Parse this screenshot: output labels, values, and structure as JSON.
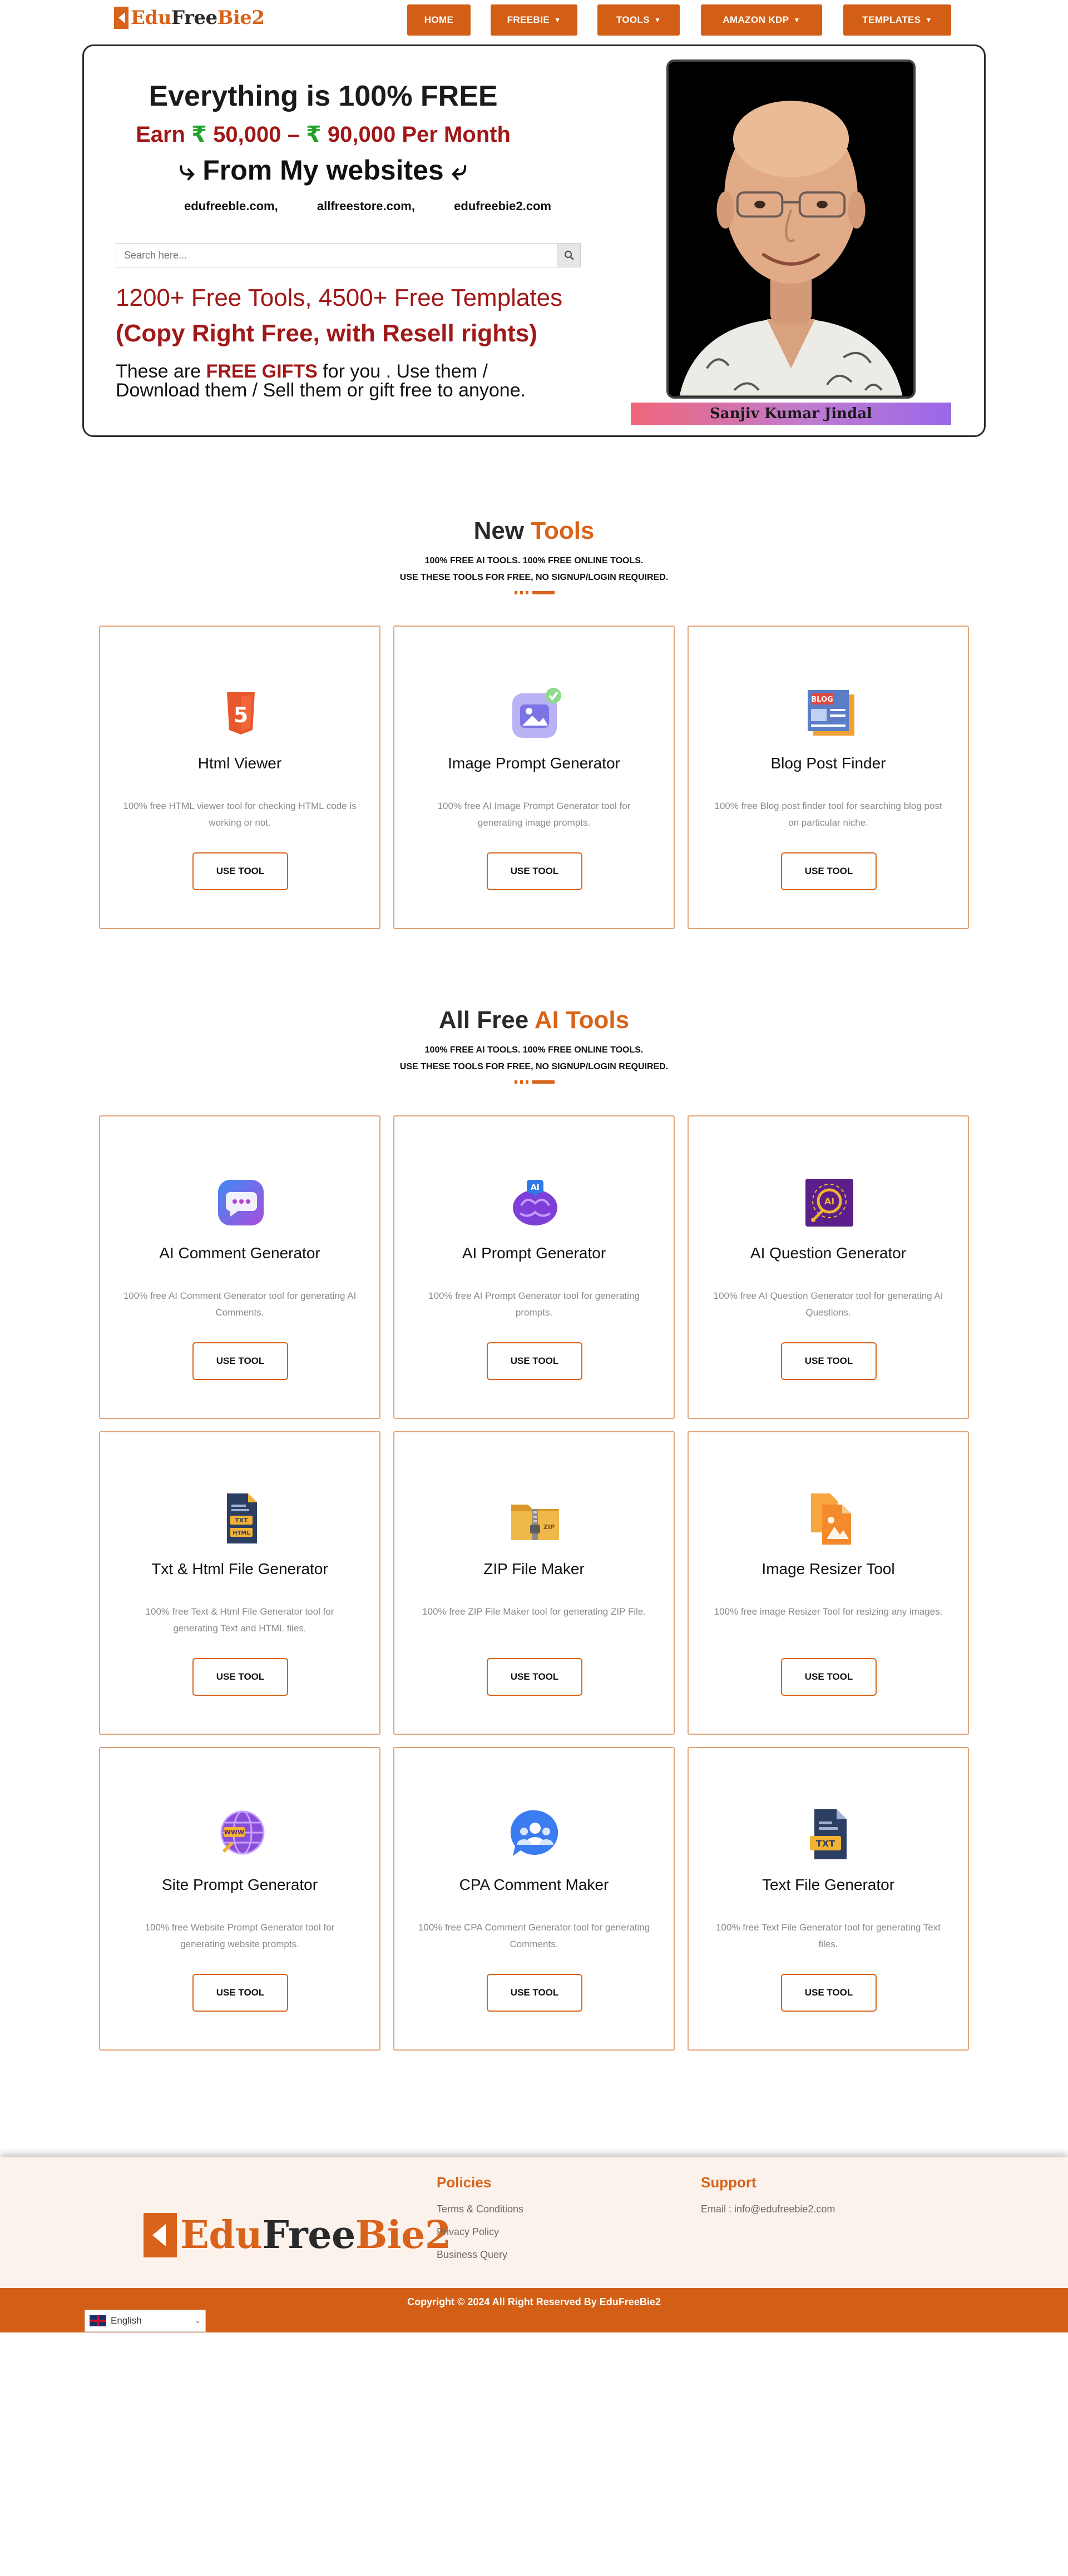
{
  "brand": {
    "part1": "Edu",
    "part2": "Free",
    "part3": "Bie2"
  },
  "nav": [
    {
      "label": "HOME",
      "dropdown": false
    },
    {
      "label": "FREEBIE",
      "dropdown": true
    },
    {
      "label": "TOOLS",
      "dropdown": true
    },
    {
      "label": "AMAZON KDP",
      "dropdown": true
    },
    {
      "label": "TEMPLATES",
      "dropdown": true
    }
  ],
  "hero": {
    "title": "Everything is 100% FREE",
    "earn_prefix": "Earn",
    "rupee": "₹",
    "earn_low": "50,000",
    "earn_dash": "–",
    "earn_high": "90,000 Per Month",
    "from": "⤷ From My websites ⤶",
    "sites": [
      "edufreeble.com,",
      "allfreestore.com,",
      "edufreebie2.com"
    ],
    "search_placeholder": "Search here...",
    "tools_line": "1200+ Free Tools, 4500+ Free Templates",
    "copyright_line": "(Copy Right Free, with Resell rights)",
    "gifts_prefix": "These are",
    "gifts_highlight": "FREE GIFTS",
    "gifts_suffix": "for you . Use them / Download them / Sell them or gift free to anyone.",
    "person_name": "Sanjiv Kumar Jindal"
  },
  "new_tools": {
    "title_plain": "New",
    "title_accent": "Tools",
    "sub_line1": "100% FREE AI TOOLS. 100% FREE ONLINE TOOLS.",
    "sub_line2": "USE THESE TOOLS FOR FREE, NO SIGNUP/LOGIN REQUIRED.",
    "cards": [
      {
        "icon": "html5-icon",
        "title": "Html Viewer",
        "desc": "100% free HTML viewer tool for checking HTML code is working or not.",
        "button": "USE TOOL"
      },
      {
        "icon": "image-prompt-icon",
        "title": "Image Prompt Generator",
        "desc": "100% free AI Image Prompt Generator tool for generating image prompts.",
        "button": "USE TOOL"
      },
      {
        "icon": "blog-icon",
        "title": "Blog Post Finder",
        "desc": "100% free Blog post finder tool for searching blog post on particular niche.",
        "button": "USE TOOL"
      }
    ]
  },
  "all_tools": {
    "title_plain": "All Free",
    "title_accent": "AI Tools",
    "sub_line1": "100% FREE AI TOOLS. 100% FREE ONLINE TOOLS.",
    "sub_line2": "USE THESE TOOLS FOR FREE, NO SIGNUP/LOGIN REQUIRED.",
    "cards": [
      {
        "icon": "chat-bubble-icon",
        "title": "AI Comment Generator",
        "desc": "100% free AI Comment Generator tool for generating AI Comments.",
        "button": "USE TOOL"
      },
      {
        "icon": "ai-brain-icon",
        "title": "AI Prompt Generator",
        "desc": "100% free AI Prompt Generator tool for generating prompts.",
        "button": "USE TOOL"
      },
      {
        "icon": "ai-question-icon",
        "title": "AI Question Generator",
        "desc": "100% free AI Question Generator tool for generating AI Questions.",
        "button": "USE TOOL"
      },
      {
        "icon": "txt-html-file-icon",
        "title": "Txt & Html File Generator",
        "desc": "100% free Text & Html File Generator tool for generating Text and HTML files.",
        "button": "USE TOOL"
      },
      {
        "icon": "zip-folder-icon",
        "title": "ZIP File Maker",
        "desc": "100% free ZIP File Maker tool for generating ZIP File.",
        "button": "USE TOOL"
      },
      {
        "icon": "image-files-icon",
        "title": "Image Resizer Tool",
        "desc": "100% free image Resizer Tool for resizing any images.",
        "button": "USE TOOL"
      },
      {
        "icon": "globe-www-icon",
        "title": "Site Prompt Generator",
        "desc": "100% free Website Prompt Generator tool for generating website prompts.",
        "button": "USE TOOL"
      },
      {
        "icon": "users-icon",
        "title": "CPA Comment Maker",
        "desc": "100% free CPA Comment Generator tool for generating Comments.",
        "button": "USE TOOL"
      },
      {
        "icon": "txt-file-icon",
        "title": "Text File Generator",
        "desc": "100% free Text File Generator tool for generating Text files.",
        "button": "USE TOOL"
      }
    ]
  },
  "footer": {
    "policies_title": "Policies",
    "policies": [
      "Terms & Conditions",
      "Privacy Policy",
      "Business Query"
    ],
    "support_title": "Support",
    "support_email": "Email : info@edufreebie2.com",
    "copyright": "Copyright © 2024 All Right Reserved By EduFreeBie2",
    "language": "English"
  },
  "colors": {
    "accent": "#d9631a",
    "nav": "#d35f17",
    "red_text": "#a01818",
    "card_border": "#e2a47a",
    "footer_bg": "#fbf2ec"
  }
}
